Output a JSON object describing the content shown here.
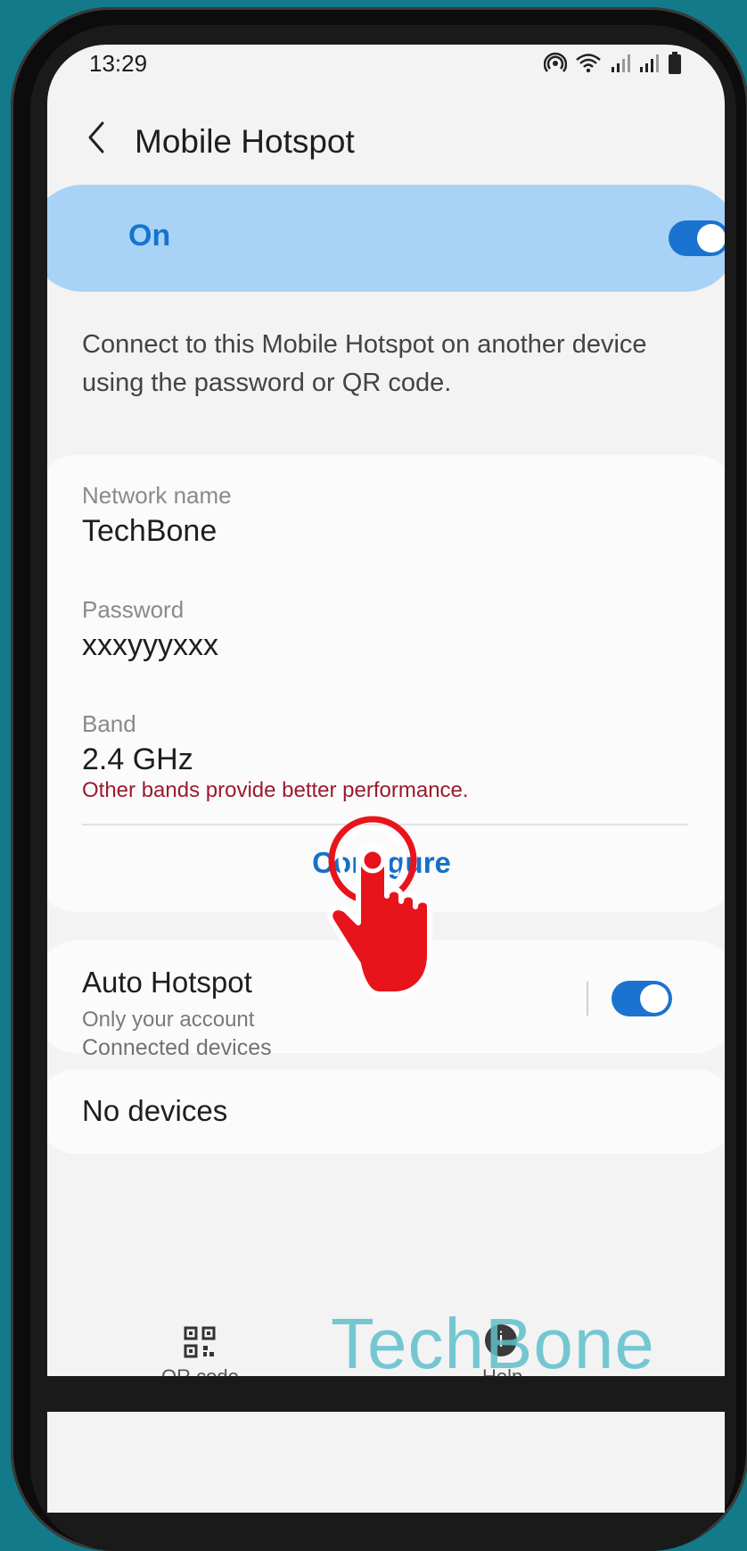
{
  "status_bar": {
    "time": "13:29",
    "icons": [
      "hotspot-icon",
      "wifi-icon",
      "signal-icon",
      "signal-icon",
      "battery-icon"
    ]
  },
  "header": {
    "title": "Mobile Hotspot"
  },
  "master_switch": {
    "label": "On",
    "enabled": true
  },
  "description": "Connect to this Mobile Hotspot on another device using the password or QR code.",
  "network": {
    "name_label": "Network name",
    "name_value": "TechBone",
    "password_label": "Password",
    "password_value": "xxxyyyxxx",
    "band_label": "Band",
    "band_value": "2.4 GHz",
    "band_warning": "Other bands provide better performance.",
    "configure_label": "Configure"
  },
  "auto_hotspot": {
    "title": "Auto Hotspot",
    "subtitle": "Only your account",
    "enabled": true
  },
  "connected_devices": {
    "header": "Connected devices",
    "empty_text": "No devices"
  },
  "bottom_bar": {
    "qr_label": "QR code",
    "help_label": "Help"
  },
  "watermark": "TechBone",
  "colors": {
    "accent": "#1574d0",
    "banner": "#a8d3f6",
    "warning": "#9b1a2c",
    "background": "#127a88",
    "tap_hand": "#e8141c"
  }
}
